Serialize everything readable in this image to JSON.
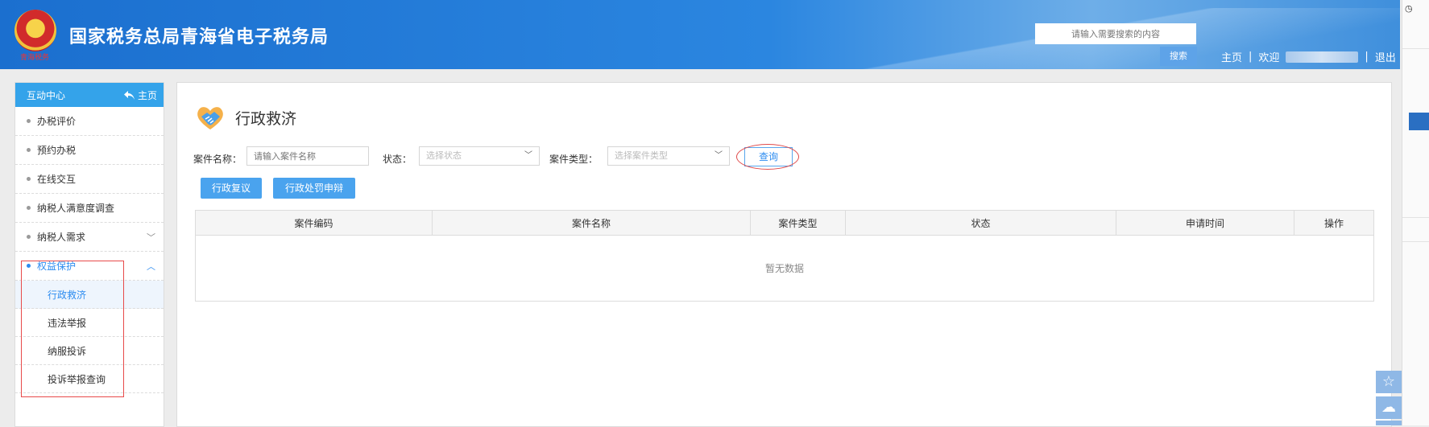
{
  "header": {
    "site_title": "国家税务总局青海省电子税务局",
    "emblem_sub": "青海税务",
    "search_placeholder": "请输入需要搜索的内容",
    "search_button": "搜索",
    "home_link": "主页",
    "separator": "|",
    "welcome": "欢迎",
    "logout": "退出"
  },
  "sidebar": {
    "title": "互动中心",
    "home_label": "主页",
    "items": [
      {
        "label": "办税评价"
      },
      {
        "label": "预约办税"
      },
      {
        "label": "在线交互"
      },
      {
        "label": "纳税人满意度调查"
      },
      {
        "label": "纳税人需求",
        "chevron": "﹀"
      },
      {
        "label": "权益保护",
        "chevron": "︿"
      }
    ],
    "sub_items": [
      {
        "label": "行政救济"
      },
      {
        "label": "违法举报"
      },
      {
        "label": "纳服投诉"
      },
      {
        "label": "投诉举报查询"
      }
    ]
  },
  "main": {
    "title": "行政救济",
    "filters": {
      "case_name_label": "案件名称：",
      "case_name_placeholder": "请输入案件名称",
      "status_label": "状态：",
      "status_placeholder": "选择状态",
      "case_type_label": "案件类型：",
      "case_type_placeholder": "选择案件类型",
      "query_button": "查询"
    },
    "buttons": {
      "review": "行政复议",
      "defense": "行政处罚申辩"
    },
    "table": {
      "columns": [
        "案件编码",
        "案件名称",
        "案件类型",
        "状态",
        "申请时间",
        "操作"
      ],
      "empty_text": "暂无数据"
    }
  },
  "colors": {
    "header_blue": "#1b6fcf",
    "accent": "#2d8cf0",
    "button_blue": "#4aa3ee",
    "annotation_red": "#e04a4a"
  }
}
